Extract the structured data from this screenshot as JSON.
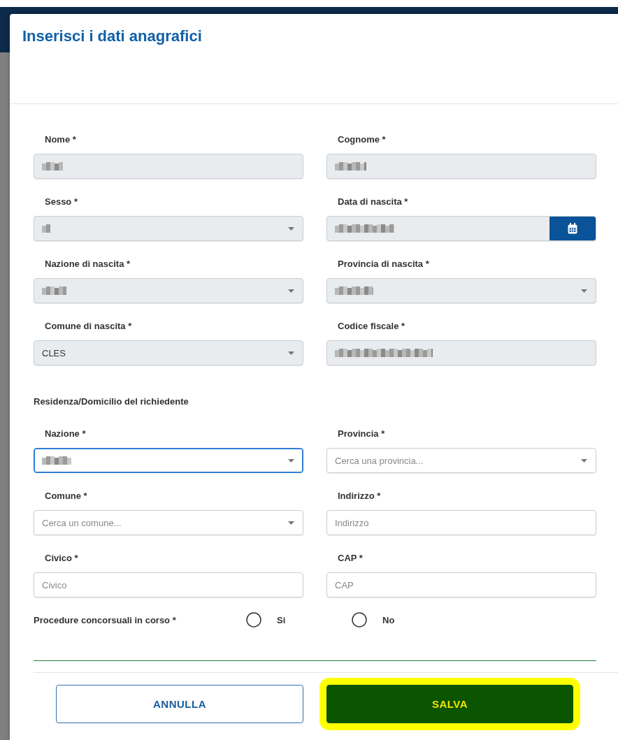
{
  "dialog": {
    "title": "Inserisci i dati anagrafici",
    "sections": [
      {
        "fields": [
          {
            "label": "Nome *",
            "kind": "text",
            "disabled": true,
            "redacted": true
          },
          {
            "label": "Cognome *",
            "kind": "text",
            "disabled": true,
            "redacted": true
          },
          {
            "label": "Sesso *",
            "kind": "select",
            "disabled": true,
            "redacted": true
          },
          {
            "label": "Data di nascita *",
            "kind": "date",
            "disabled": true,
            "redacted": true
          },
          {
            "label": "Nazione di nascita *",
            "kind": "select",
            "disabled": true,
            "redacted": true
          },
          {
            "label": "Provincia di nascita *",
            "kind": "select",
            "disabled": true,
            "redacted": true
          },
          {
            "label": "Comune di nascita *",
            "kind": "select",
            "disabled": true,
            "value": "CLES"
          },
          {
            "label": "Codice fiscale *",
            "kind": "text",
            "disabled": true,
            "redacted": true
          }
        ]
      },
      {
        "heading": "Residenza/Domicilio del richiedente",
        "fields": [
          {
            "label": "Nazione *",
            "kind": "select",
            "disabled": false,
            "focused": true,
            "redacted": true
          },
          {
            "label": "Provincia *",
            "kind": "select",
            "disabled": false,
            "placeholder": "Cerca una provincia..."
          },
          {
            "label": "Comune *",
            "kind": "select",
            "disabled": false,
            "placeholder": "Cerca un comune..."
          },
          {
            "label": "Indirizzo *",
            "kind": "text",
            "disabled": false,
            "placeholder": "Indirizzo"
          },
          {
            "label": "Civico *",
            "kind": "text",
            "disabled": false,
            "placeholder": "Civico"
          },
          {
            "label": "CAP *",
            "kind": "text",
            "disabled": false,
            "placeholder": "CAP"
          }
        ]
      }
    ],
    "question": {
      "label": "Procedure concorsuali in corso *",
      "options": [
        {
          "label": "Si",
          "selected": false
        },
        {
          "label": "No",
          "selected": false
        }
      ]
    },
    "buttons": [
      {
        "label": "ANNULLA",
        "kind": "secondary",
        "highlighted": false
      },
      {
        "label": "SALVA",
        "kind": "primary",
        "highlighted": true
      }
    ]
  }
}
